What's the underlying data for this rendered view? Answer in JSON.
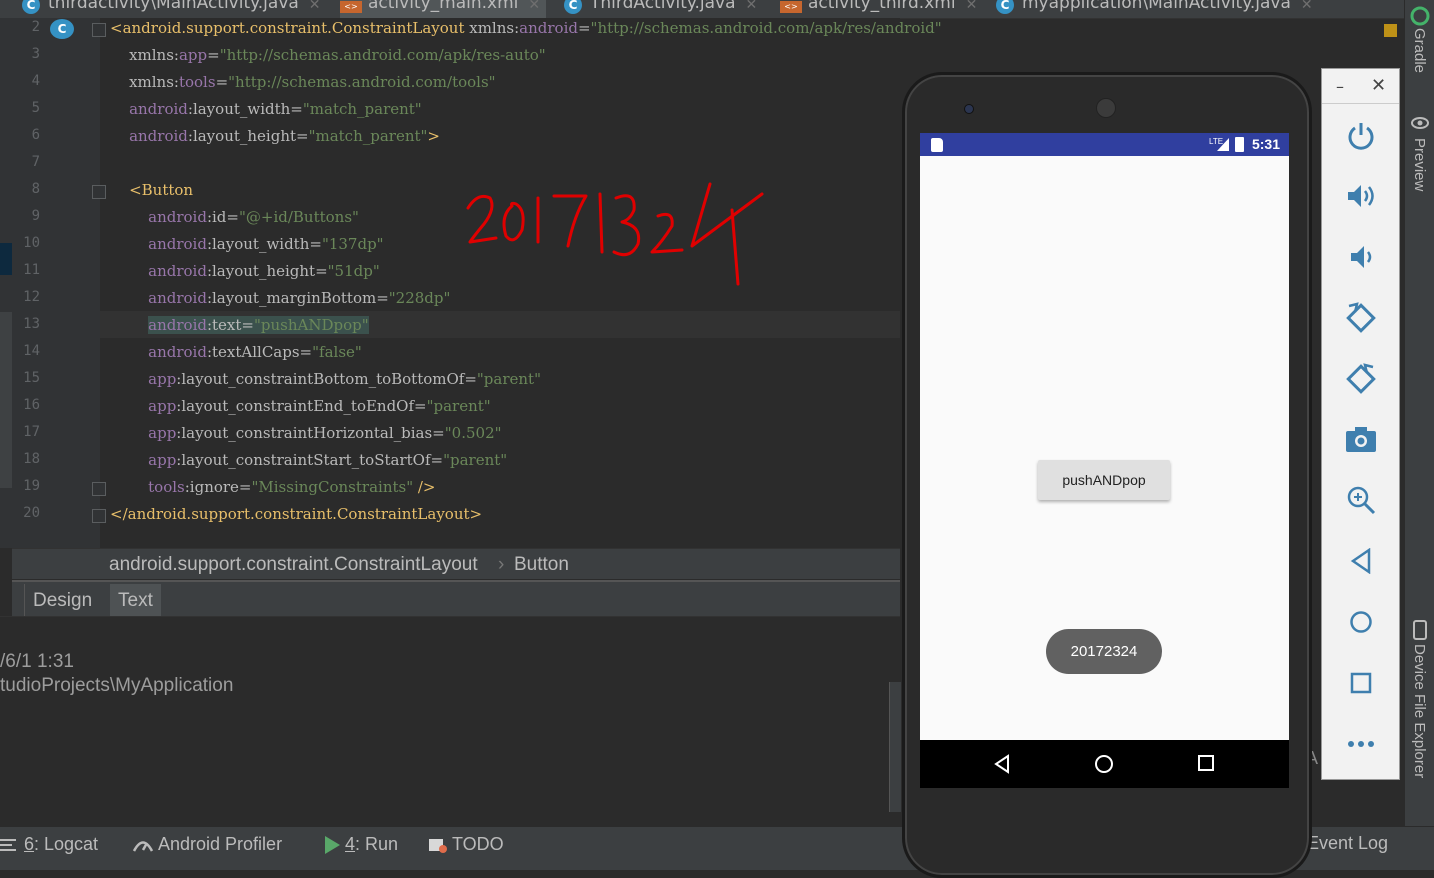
{
  "tabs": [
    {
      "label": "thirdactivity\\MainActivity.java",
      "icon": "java-class-icon",
      "active": false
    },
    {
      "label": "activity_main.xml",
      "icon": "xml-file-icon",
      "active": true
    },
    {
      "label": "ThirdActivity.java",
      "icon": "java-class-icon",
      "active": false
    },
    {
      "label": "activity_third.xml",
      "icon": "xml-file-icon",
      "active": false
    },
    {
      "label": "myapplication\\MainActivity.java",
      "icon": "java-class-icon",
      "active": false
    }
  ],
  "editor": {
    "line_numbers": [
      "2",
      "3",
      "4",
      "5",
      "6",
      "7",
      "8",
      "9",
      "10",
      "11",
      "12",
      "13",
      "14",
      "15",
      "16",
      "17",
      "18",
      "19",
      "20"
    ],
    "lines": [
      {
        "parts": [
          {
            "c": "",
            "t": "<android.support.constraint.ConstraintLayout "
          },
          {
            "c": "at",
            "t": "xmlns:"
          },
          {
            "c": "ns",
            "t": "android"
          },
          {
            "c": "at",
            "t": "="
          },
          {
            "c": "str",
            "t": "\"http://schemas.android.com/apk/res/android\""
          }
        ]
      },
      {
        "parts": [
          {
            "c": "at",
            "t": "    xmlns:"
          },
          {
            "c": "ns",
            "t": "app"
          },
          {
            "c": "at",
            "t": "="
          },
          {
            "c": "str",
            "t": "\"http://schemas.android.com/apk/res-auto\""
          }
        ]
      },
      {
        "parts": [
          {
            "c": "at",
            "t": "    xmlns:"
          },
          {
            "c": "ns",
            "t": "tools"
          },
          {
            "c": "at",
            "t": "="
          },
          {
            "c": "str",
            "t": "\"http://schemas.android.com/tools\""
          }
        ]
      },
      {
        "parts": [
          {
            "c": "ns",
            "t": "    android"
          },
          {
            "c": "at",
            "t": ":layout_width="
          },
          {
            "c": "str",
            "t": "\"match_parent\""
          }
        ]
      },
      {
        "parts": [
          {
            "c": "ns",
            "t": "    android"
          },
          {
            "c": "at",
            "t": ":layout_height="
          },
          {
            "c": "str",
            "t": "\"match_parent\""
          },
          {
            "c": "",
            "t": ">"
          }
        ]
      },
      {
        "parts": [
          {
            "c": "",
            "t": ""
          }
        ]
      },
      {
        "parts": [
          {
            "c": "",
            "t": "    <Button"
          }
        ]
      },
      {
        "parts": [
          {
            "c": "ns",
            "t": "        android"
          },
          {
            "c": "at",
            "t": ":id="
          },
          {
            "c": "str",
            "t": "\"@+id/Buttons\""
          }
        ]
      },
      {
        "parts": [
          {
            "c": "ns",
            "t": "        android"
          },
          {
            "c": "at",
            "t": ":layout_width="
          },
          {
            "c": "str",
            "t": "\"137dp\""
          }
        ]
      },
      {
        "parts": [
          {
            "c": "ns",
            "t": "        android"
          },
          {
            "c": "at",
            "t": ":layout_height="
          },
          {
            "c": "str",
            "t": "\"51dp\""
          }
        ]
      },
      {
        "parts": [
          {
            "c": "ns",
            "t": "        android"
          },
          {
            "c": "at",
            "t": ":layout_marginBottom="
          },
          {
            "c": "str",
            "t": "\"228dp\""
          }
        ]
      },
      {
        "parts": [
          {
            "c": "",
            "t": "        "
          },
          {
            "c": "ns sel",
            "t": "android"
          },
          {
            "c": "at sel",
            "t": ":text="
          },
          {
            "c": "str sel",
            "t": "\"pushANDpop\""
          }
        ]
      },
      {
        "parts": [
          {
            "c": "ns",
            "t": "        android"
          },
          {
            "c": "at",
            "t": ":textAllCaps="
          },
          {
            "c": "str",
            "t": "\"false\""
          }
        ]
      },
      {
        "parts": [
          {
            "c": "ns",
            "t": "        app"
          },
          {
            "c": "at",
            "t": ":layout_constraintBottom_toBottomOf="
          },
          {
            "c": "str",
            "t": "\"parent\""
          }
        ]
      },
      {
        "parts": [
          {
            "c": "ns",
            "t": "        app"
          },
          {
            "c": "at",
            "t": ":layout_constraintEnd_toEndOf="
          },
          {
            "c": "str",
            "t": "\"parent\""
          }
        ]
      },
      {
        "parts": [
          {
            "c": "ns",
            "t": "        app"
          },
          {
            "c": "at",
            "t": ":layout_constraintHorizontal_bias="
          },
          {
            "c": "str",
            "t": "\"0.502\""
          }
        ]
      },
      {
        "parts": [
          {
            "c": "ns",
            "t": "        app"
          },
          {
            "c": "at",
            "t": ":layout_constraintStart_toStartOf="
          },
          {
            "c": "str",
            "t": "\"parent\""
          }
        ]
      },
      {
        "parts": [
          {
            "c": "ns",
            "t": "        tools"
          },
          {
            "c": "at",
            "t": ":ignore="
          },
          {
            "c": "str",
            "t": "\"MissingConstraints\""
          },
          {
            "c": "",
            "t": " />"
          }
        ]
      },
      {
        "parts": [
          {
            "c": "",
            "t": "</android.support.constraint.ConstraintLayout>"
          }
        ]
      }
    ],
    "handwritten_annotation": "20172324"
  },
  "breadcrumb": {
    "root": "android.support.constraint.ConstraintLayout",
    "separator": "›",
    "leaf": "Button"
  },
  "view_tabs": {
    "design": "Design",
    "text": "Text",
    "selected": "Text"
  },
  "log_panel": {
    "line1": "/6/1 1:31",
    "line2": "tudioProjects\\MyApplication"
  },
  "tool_windows": [
    {
      "num": "6",
      "label": ": Logcat",
      "icon": "logcat-icon"
    },
    {
      "num": "",
      "label": "Android Profiler",
      "icon": "profiler-icon"
    },
    {
      "num": "4",
      "label": ": Run",
      "icon": "run-icon"
    },
    {
      "num": "",
      "label": "TODO",
      "icon": "todo-icon"
    }
  ],
  "event_log": "Event Log",
  "side_panels": {
    "gradle": "Gradle",
    "preview": "Preview",
    "device_explorer": "Device File Explorer",
    "partial_a": "A",
    "partial_i": "I"
  },
  "phone": {
    "status_time": "5:31",
    "status_network": "LTE",
    "button_push_label": "pushANDpop",
    "button_pill_label": "20172324"
  },
  "emulator_controls": [
    "power-icon",
    "volume-up-icon",
    "volume-down-icon",
    "rotate-left-icon",
    "rotate-right-icon",
    "camera-icon",
    "zoom-icon",
    "back-icon",
    "home-icon",
    "overview-icon",
    "more-icon"
  ],
  "emulator_window": {
    "minimize": "–",
    "close": "✕"
  },
  "colors": {
    "accent_blue": "#3592c4",
    "status_bar": "#303f9f",
    "annotation_red": "#e00000"
  }
}
